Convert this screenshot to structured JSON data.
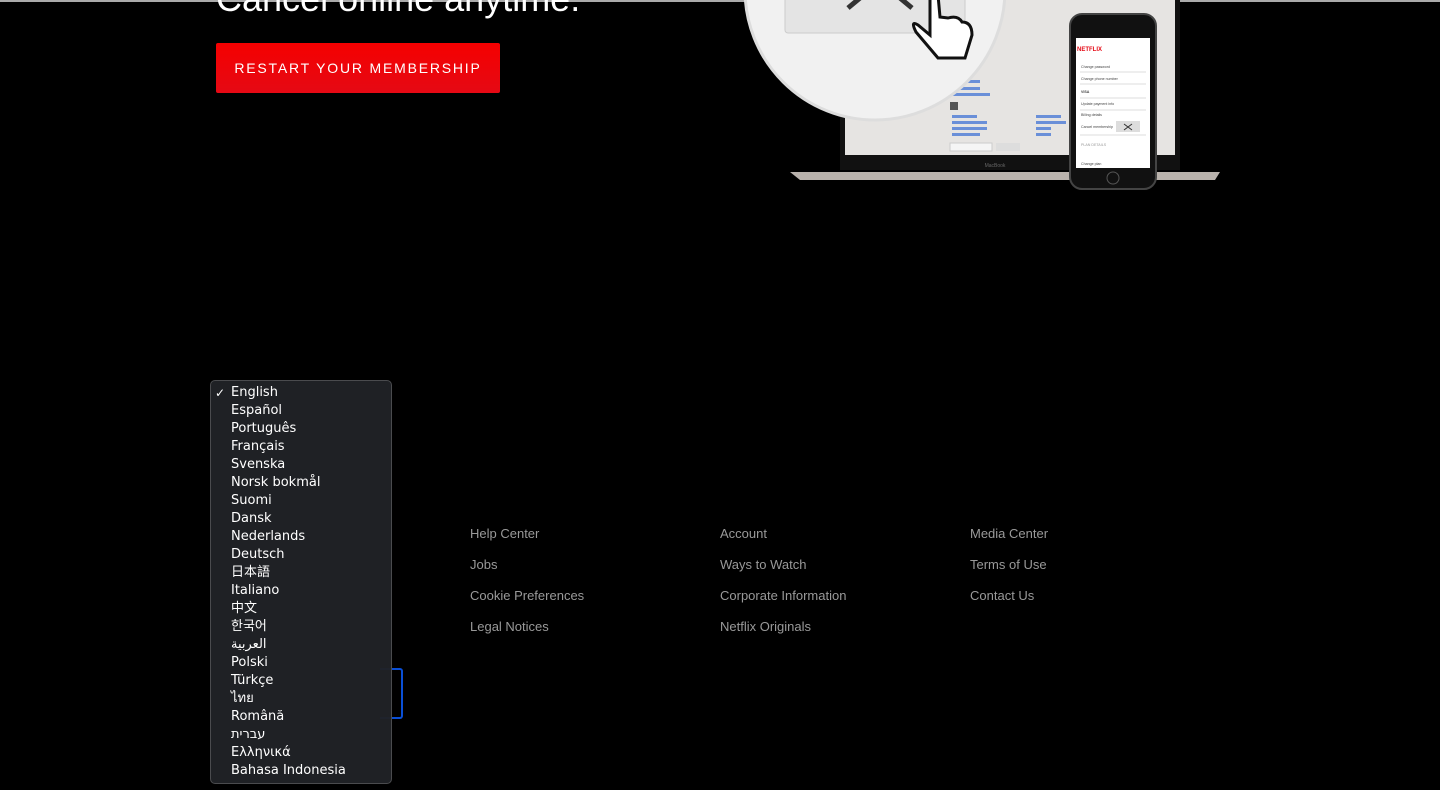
{
  "hero": {
    "headline": "Cancel online anytime.",
    "restart_button": "RESTART YOUR MEMBERSHIP"
  },
  "illustration": {
    "phone_brand": "NETFLIX",
    "phone_rows": [
      "Change password",
      "Change phone number",
      "VISA",
      "Update payment info",
      "Billing details",
      "Cancel membership",
      "PLAN DETAILS",
      "Change plan"
    ],
    "laptop_label": "MacBook"
  },
  "footer": {
    "columns": [
      [
        "Help Center",
        "Jobs",
        "Cookie Preferences",
        "Legal Notices"
      ],
      [
        "Account",
        "Ways to Watch",
        "Corporate Information",
        "Netflix Originals"
      ],
      [
        "Media Center",
        "Terms of Use",
        "Contact Us"
      ]
    ]
  },
  "language_menu": {
    "selected": "English",
    "options": [
      "English",
      "Español",
      "Português",
      "Français",
      "Svenska",
      "Norsk bokmål",
      "Suomi",
      "Dansk",
      "Nederlands",
      "Deutsch",
      "日本語",
      "Italiano",
      "中文",
      "한국어",
      "العربية",
      "Polski",
      "Türkçe",
      "ไทย",
      "Română",
      "עברית",
      "Ελληνικά",
      "Bahasa Indonesia"
    ]
  },
  "colors": {
    "accent": "#e50914",
    "link": "#999999",
    "focus": "#0a4fd6"
  }
}
